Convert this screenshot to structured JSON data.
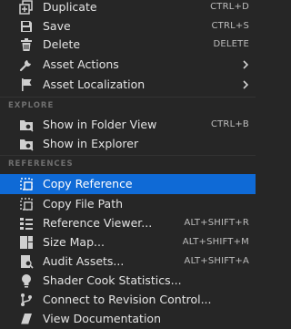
{
  "menu": {
    "items_top": [
      {
        "label": "Duplicate",
        "shortcut": "CTRL+D",
        "icon": "duplicate-icon"
      },
      {
        "label": "Save",
        "shortcut": "CTRL+S",
        "icon": "save-icon"
      },
      {
        "label": "Delete",
        "shortcut": "DELETE",
        "icon": "delete-icon"
      },
      {
        "label": "Asset Actions",
        "submenu": true,
        "icon": "wrench-icon"
      },
      {
        "label": "Asset Localization",
        "submenu": true,
        "icon": "flag-icon"
      }
    ],
    "explore": {
      "header": "EXPLORE",
      "items": [
        {
          "label": "Show in Folder View",
          "shortcut": "CTRL+B",
          "icon": "folder-search-icon"
        },
        {
          "label": "Show in Explorer",
          "icon": "folder-search-icon"
        }
      ]
    },
    "references": {
      "header": "REFERENCES",
      "items": [
        {
          "label": "Copy Reference",
          "selected": true,
          "icon": "copy-reference-icon"
        },
        {
          "label": "Copy File Path",
          "icon": "copy-path-icon"
        },
        {
          "label": "Reference Viewer...",
          "shortcut": "ALT+SHIFT+R",
          "icon": "reference-viewer-icon"
        },
        {
          "label": "Size Map...",
          "shortcut": "ALT+SHIFT+M",
          "icon": "size-map-icon"
        },
        {
          "label": "Audit Assets...",
          "shortcut": "ALT+SHIFT+A",
          "icon": "audit-icon"
        },
        {
          "label": "Shader Cook Statistics...",
          "icon": "lightbulb-icon"
        },
        {
          "label": "Connect to Revision Control...",
          "icon": "branch-icon"
        },
        {
          "label": "View Documentation",
          "icon": "book-icon"
        }
      ]
    }
  },
  "colors": {
    "background": "#262626",
    "selected": "#0f6ad6",
    "text": "#e4e4e4",
    "shortcut": "#bdbdbd",
    "section_header": "#6f6f6f"
  }
}
